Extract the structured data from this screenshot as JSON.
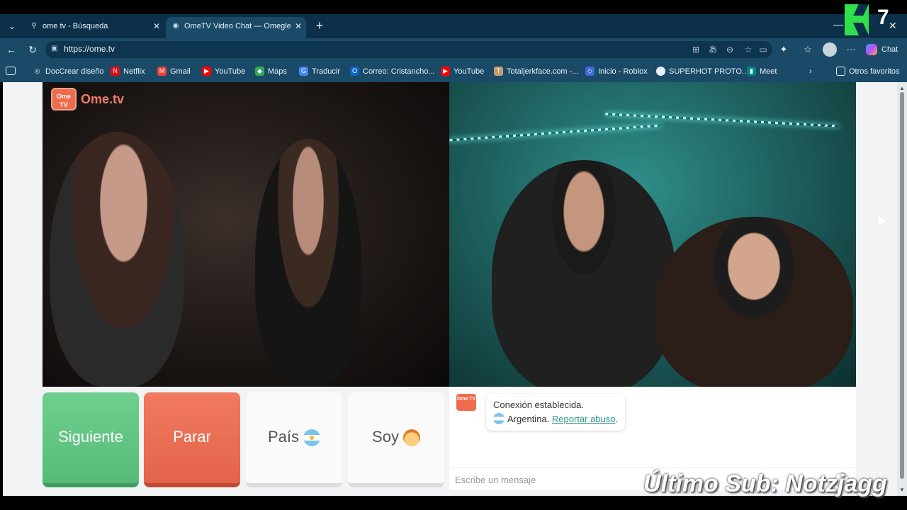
{
  "browser": {
    "tabs": [
      {
        "title": "ome tv - Búsqueda",
        "icon": "search-icon",
        "active": false
      },
      {
        "title": "OmeTV Video Chat — Omegle",
        "icon": "ometv-favicon",
        "active": true
      }
    ],
    "url": "https://ome.tv",
    "chat_label": "Chat",
    "bookmarks": [
      {
        "label": "DocCrear diseño",
        "icon": "globe-icon"
      },
      {
        "label": "Netflix",
        "icon": "netflix-icon"
      },
      {
        "label": "Gmail",
        "icon": "gmail-icon"
      },
      {
        "label": "YouTube",
        "icon": "youtube-icon"
      },
      {
        "label": "Maps",
        "icon": "maps-icon"
      },
      {
        "label": "Traducir",
        "icon": "translate-icon"
      },
      {
        "label": "Correo: Cristancho...",
        "icon": "outlook-icon"
      },
      {
        "label": "YouTube",
        "icon": "youtube-icon"
      },
      {
        "label": "Totaljerkface.com -...",
        "icon": "site-icon"
      },
      {
        "label": "Inicio - Roblox",
        "icon": "roblox-icon"
      },
      {
        "label": "SUPERHOT PROTO...",
        "icon": "superhot-icon"
      },
      {
        "label": "Meet",
        "icon": "meet-icon"
      }
    ],
    "other_favorites": "Otros favoritos",
    "overlay_number": "7"
  },
  "app": {
    "logo_box": "Ome TV",
    "logo_text": "Ome.tv",
    "buttons": {
      "next": "Siguiente",
      "stop": "Parar",
      "country": "País",
      "soy": "Soy"
    },
    "chat": {
      "logo": "Ome TV",
      "connected": "Conexión establecida.",
      "country": "Argentina.",
      "report": "Reportar abuso",
      "period": ".",
      "placeholder": "Escribe un mensaje"
    }
  },
  "watermark": "Último Sub: Notzjagg",
  "colors": {
    "next": "#5cc07d",
    "stop": "#e86a50",
    "accent": "#f06b4d",
    "link": "#2a9a8a"
  }
}
